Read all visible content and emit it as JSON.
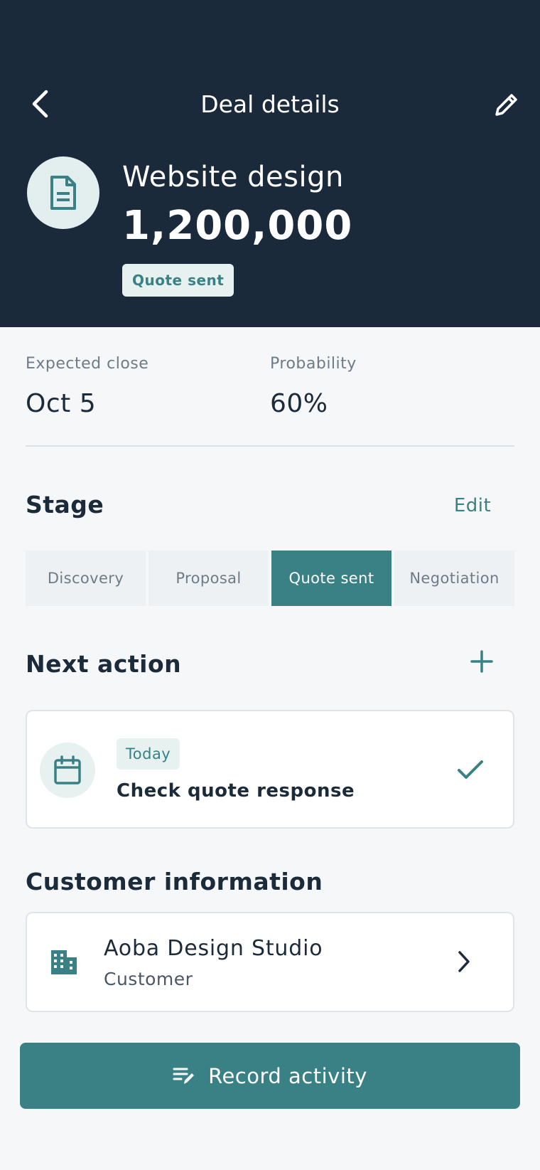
{
  "header": {
    "title": "Deal details",
    "back_icon": "chevron-left-icon",
    "edit_icon": "pencil-icon"
  },
  "deal": {
    "icon": "document-icon",
    "name": "Website design",
    "amount": "1,200,000",
    "status": "Quote sent"
  },
  "metrics": {
    "expected_close_label": "Expected close",
    "expected_close_value": "Oct 5",
    "probability_label": "Probability",
    "probability_value": "60%"
  },
  "stage": {
    "title": "Stage",
    "edit_label": "Edit",
    "options": [
      "Discovery",
      "Proposal",
      "Quote sent",
      "Negotiation"
    ],
    "active": "Quote sent"
  },
  "next_action": {
    "title": "Next action",
    "add_icon": "plus-icon",
    "item": {
      "icon": "calendar-icon",
      "when": "Today",
      "title": "Check quote response",
      "complete_icon": "check-icon"
    }
  },
  "customer": {
    "title": "Customer information",
    "icon": "building-icon",
    "name": "Aoba Design Studio",
    "role": "Customer",
    "chevron_icon": "chevron-right-icon"
  },
  "primary_action": {
    "label": "Record activity",
    "icon": "note-edit-icon"
  },
  "colors": {
    "header_bg": "#1a2a3b",
    "accent": "#3a8185",
    "accent_light": "#e6f1f0",
    "page_bg": "#f5f7f9",
    "text_primary": "#1c2b3a",
    "text_secondary": "#6e7b88"
  }
}
